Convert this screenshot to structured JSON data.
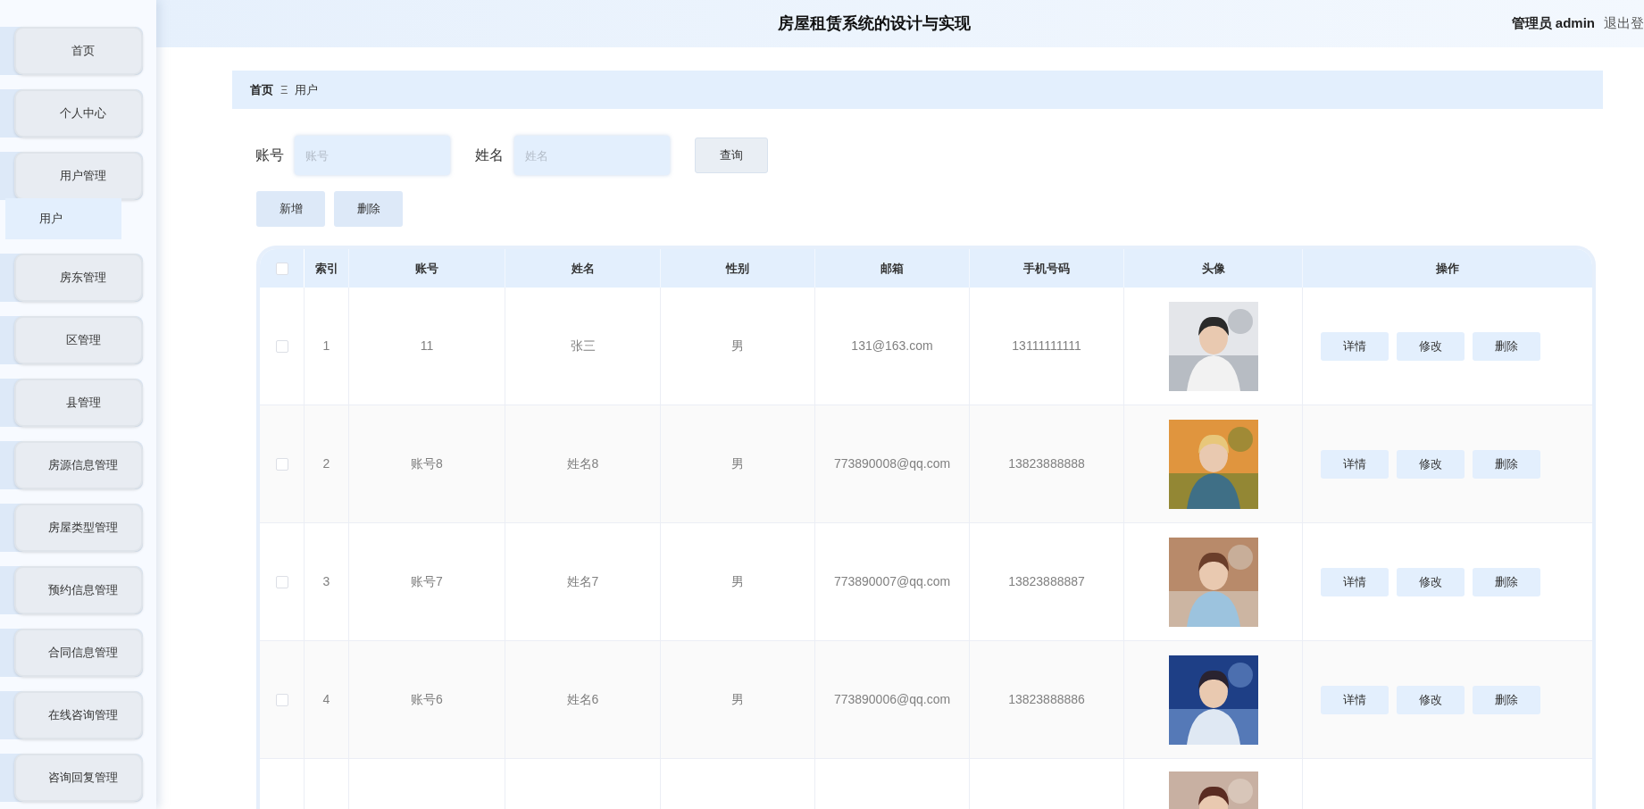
{
  "header": {
    "title": "房屋租赁系统的设计与实现",
    "user": "管理员 admin",
    "logout": "退出登"
  },
  "sidebar": {
    "items": [
      {
        "label": "首页"
      },
      {
        "label": "个人中心"
      },
      {
        "label": "用户管理",
        "children": [
          {
            "label": "用户",
            "selected": true
          }
        ]
      },
      {
        "label": "房东管理"
      },
      {
        "label": "区管理"
      },
      {
        "label": "县管理"
      },
      {
        "label": "房源信息管理"
      },
      {
        "label": "房屋类型管理"
      },
      {
        "label": "预约信息管理"
      },
      {
        "label": "合同信息管理"
      },
      {
        "label": "在线咨询管理"
      },
      {
        "label": "咨询回复管理"
      }
    ]
  },
  "breadcrumb": {
    "home": "首页",
    "separator": "Ξ",
    "current": "用户"
  },
  "search": {
    "fields": [
      {
        "label": "账号",
        "placeholder": "账号"
      },
      {
        "label": "姓名",
        "placeholder": "姓名"
      }
    ],
    "button": "查询"
  },
  "actions": [
    "新增",
    "删除"
  ],
  "table": {
    "header_checkbox": {
      "checked": false
    },
    "columns": [
      "索引",
      "账号",
      "姓名",
      "性别",
      "邮箱",
      "手机号码",
      "头像",
      "操作"
    ],
    "rows": [
      {
        "kind": "full",
        "checked": false,
        "cells": [
          "1",
          "11",
          "张三",
          "男",
          "131@163.com",
          "13111111111"
        ],
        "buttons": [
          "详情",
          "修改",
          "删除"
        ]
      },
      {
        "kind": "full",
        "checked": false,
        "cells": [
          "2",
          "账号8",
          "姓名8",
          "男",
          "773890008@qq.com",
          "13823888888"
        ],
        "buttons": [
          "详情",
          "修改",
          "删除"
        ]
      },
      {
        "kind": "full",
        "checked": false,
        "cells": [
          "3",
          "账号7",
          "姓名7",
          "男",
          "773890007@qq.com",
          "13823888887"
        ],
        "buttons": [
          "详情",
          "修改",
          "删除"
        ]
      },
      {
        "kind": "full",
        "checked": false,
        "cells": [
          "4",
          "账号6",
          "姓名6",
          "男",
          "773890006@qq.com",
          "13823888886"
        ],
        "buttons": [
          "详情",
          "修改",
          "删除"
        ]
      },
      {
        "kind": "partial"
      }
    ]
  }
}
